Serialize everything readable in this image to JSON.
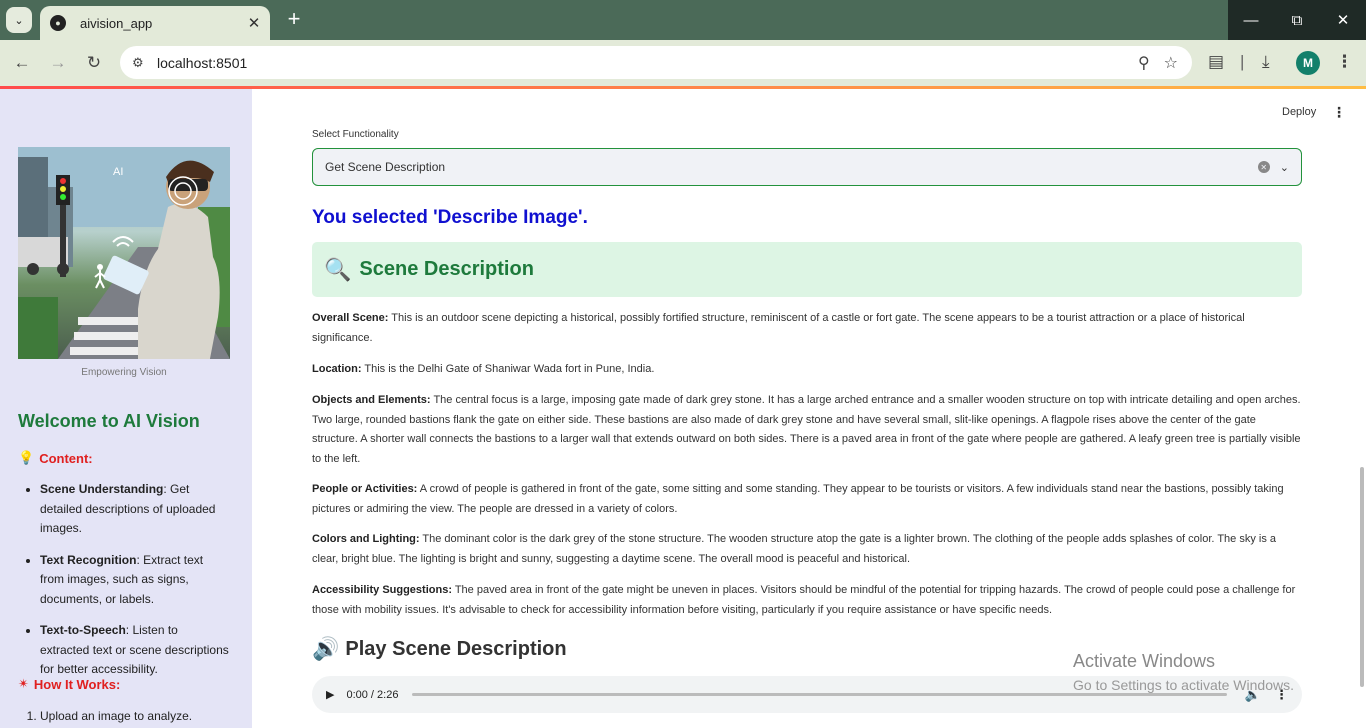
{
  "browser": {
    "tab_title": "aivision_app",
    "url": "localhost:8501",
    "avatar_letter": "M"
  },
  "header": {
    "deploy_label": "Deploy"
  },
  "sidebar": {
    "image_caption": "Empowering Vision",
    "title": "Welcome to AI Vision",
    "content_heading": "Content:",
    "content_items": [
      {
        "bold": "Scene Understanding",
        "text": ": Get detailed descriptions of uploaded images."
      },
      {
        "bold": "Text Recognition",
        "text": ": Extract text from images, such as signs, documents, or labels."
      },
      {
        "bold": "Text-to-Speech",
        "text": ": Listen to extracted text or scene descriptions for better accessibility."
      }
    ],
    "how_heading": "How It Works:",
    "how_items": [
      "Upload an image to analyze."
    ]
  },
  "main": {
    "select_label": "Select Functionality",
    "select_value": "Get Scene Description",
    "selected_heading": "You selected 'Describe Image'.",
    "scene_title": "Scene Description",
    "paragraphs": [
      {
        "bold": "Overall Scene:",
        "text": " This is an outdoor scene depicting a historical, possibly fortified structure, reminiscent of a castle or fort gate. The scene appears to be a tourist attraction or a place of historical significance."
      },
      {
        "bold": "Location:",
        "text": " This is the Delhi Gate of Shaniwar Wada fort in Pune, India."
      },
      {
        "bold": "Objects and Elements:",
        "text": " The central focus is a large, imposing gate made of dark grey stone. It has a large arched entrance and a smaller wooden structure on top with intricate detailing and open arches. Two large, rounded bastions flank the gate on either side. These bastions are also made of dark grey stone and have several small, slit-like openings. A flagpole rises above the center of the gate structure. A shorter wall connects the bastions to a larger wall that extends outward on both sides. There is a paved area in front of the gate where people are gathered. A leafy green tree is partially visible to the left."
      },
      {
        "bold": "People or Activities:",
        "text": " A crowd of people is gathered in front of the gate, some sitting and some standing. They appear to be tourists or visitors. A few individuals stand near the bastions, possibly taking pictures or admiring the view. The people are dressed in a variety of colors."
      },
      {
        "bold": "Colors and Lighting:",
        "text": " The dominant color is the dark grey of the stone structure. The wooden structure atop the gate is a lighter brown. The clothing of the people adds splashes of color. The sky is a clear, bright blue. The lighting is bright and sunny, suggesting a daytime scene. The overall mood is peaceful and historical."
      },
      {
        "bold": "Accessibility Suggestions:",
        "text": " The paved area in front of the gate might be uneven in places. Visitors should be mindful of the potential for tripping hazards. The crowd of people could pose a challenge for those with mobility issues. It's advisable to check for accessibility information before visiting, particularly if you require assistance or have specific needs."
      }
    ],
    "play_heading": "Play Scene Description",
    "audio_time": "0:00 / 2:26"
  },
  "overlay": {
    "activate_title": "Activate Windows",
    "activate_sub": "Go to Settings to activate Windows."
  },
  "colors": {
    "accent_green": "#1e7a3c",
    "heading_blue": "#1010d0",
    "sidebar_bg": "#e4e4f6"
  }
}
